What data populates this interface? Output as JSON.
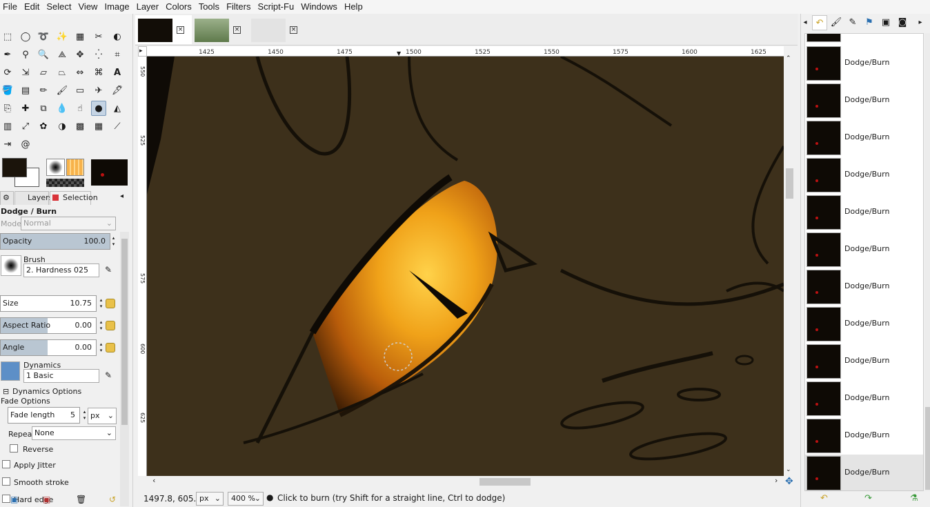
{
  "menubar": [
    "File",
    "Edit",
    "Select",
    "View",
    "Image",
    "Layer",
    "Colors",
    "Tools",
    "Filters",
    "Script-Fu",
    "Windows",
    "Help"
  ],
  "toolbox": {
    "dock_tabs": {
      "layers": "Layers",
      "selection": "Selection"
    },
    "tool_options": {
      "title": "Dodge / Burn",
      "mode_label": "Mode:",
      "mode_value": "Normal",
      "opacity_label": "Opacity",
      "opacity_value": "100.0",
      "brush_label": "Brush",
      "brush_value": "2. Hardness 025",
      "size_label": "Size",
      "size_value": "10.75",
      "aspect_label": "Aspect Ratio",
      "aspect_value": "0.00",
      "angle_label": "Angle",
      "angle_value": "0.00",
      "dynamics_label": "Dynamics",
      "dynamics_value": "1 Basic",
      "dynamics_options_label": "Dynamics Options",
      "fade_options_label": "Fade Options",
      "fade_length_label": "Fade length",
      "fade_length_value": "5",
      "fade_unit": "px",
      "repeat_label": "Repeat:",
      "repeat_value": "None",
      "reverse_label": "Reverse",
      "apply_jitter_label": "Apply Jitter",
      "smooth_stroke_label": "Smooth stroke",
      "hard_edge_label": "Hard edge"
    },
    "colors": {
      "foreground": "#1b140b",
      "background": "#ffffff"
    }
  },
  "ruler": {
    "h_ticks": [
      "1425",
      "1450",
      "1475",
      "1500",
      "1525",
      "1550",
      "1575",
      "1600",
      "1625"
    ],
    "v_ticks": [
      "550",
      "525",
      "575",
      "600",
      "625"
    ]
  },
  "status": {
    "coords": "1497.8, 605.3",
    "unit": "px",
    "zoom": "400 %",
    "message": "Click to burn (try Shift for a straight line, Ctrl to dodge)"
  },
  "history": {
    "items": [
      "Dodge/Burn",
      "Dodge/Burn",
      "Dodge/Burn",
      "Dodge/Burn",
      "Dodge/Burn",
      "Dodge/Burn",
      "Dodge/Burn",
      "Dodge/Burn",
      "Dodge/Burn",
      "Dodge/Burn",
      "Dodge/Burn",
      "Dodge/Burn"
    ]
  },
  "canvas": {
    "background_color": "#3d301b"
  }
}
